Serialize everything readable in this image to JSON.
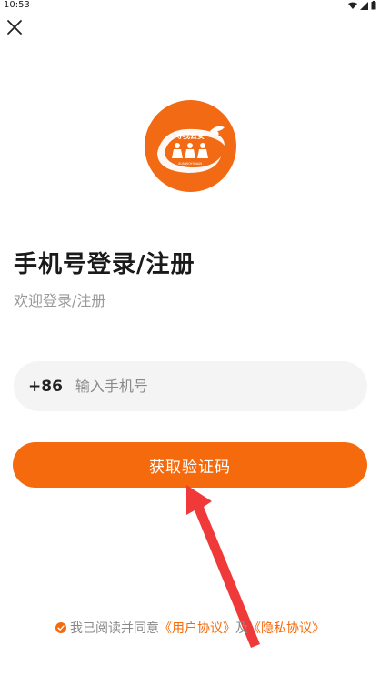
{
  "status_bar": {
    "time": "10:53"
  },
  "header": {
    "close_icon": "close-icon"
  },
  "logo": {
    "text": "寻我云安",
    "subtext": "XUNWOYUNAN"
  },
  "login": {
    "title": "手机号登录/注册",
    "subtitle": "欢迎登录/注册"
  },
  "phone": {
    "country_code": "+86",
    "placeholder": "输入手机号",
    "value": ""
  },
  "actions": {
    "get_code_label": "获取验证码"
  },
  "agreement": {
    "prefix": "我已阅读并同意",
    "user_agreement": "《用户协议》",
    "connector": "及",
    "privacy_agreement": "《隐私协议》"
  },
  "colors": {
    "accent": "#f56a0c",
    "arrow": "#f03a3a"
  }
}
